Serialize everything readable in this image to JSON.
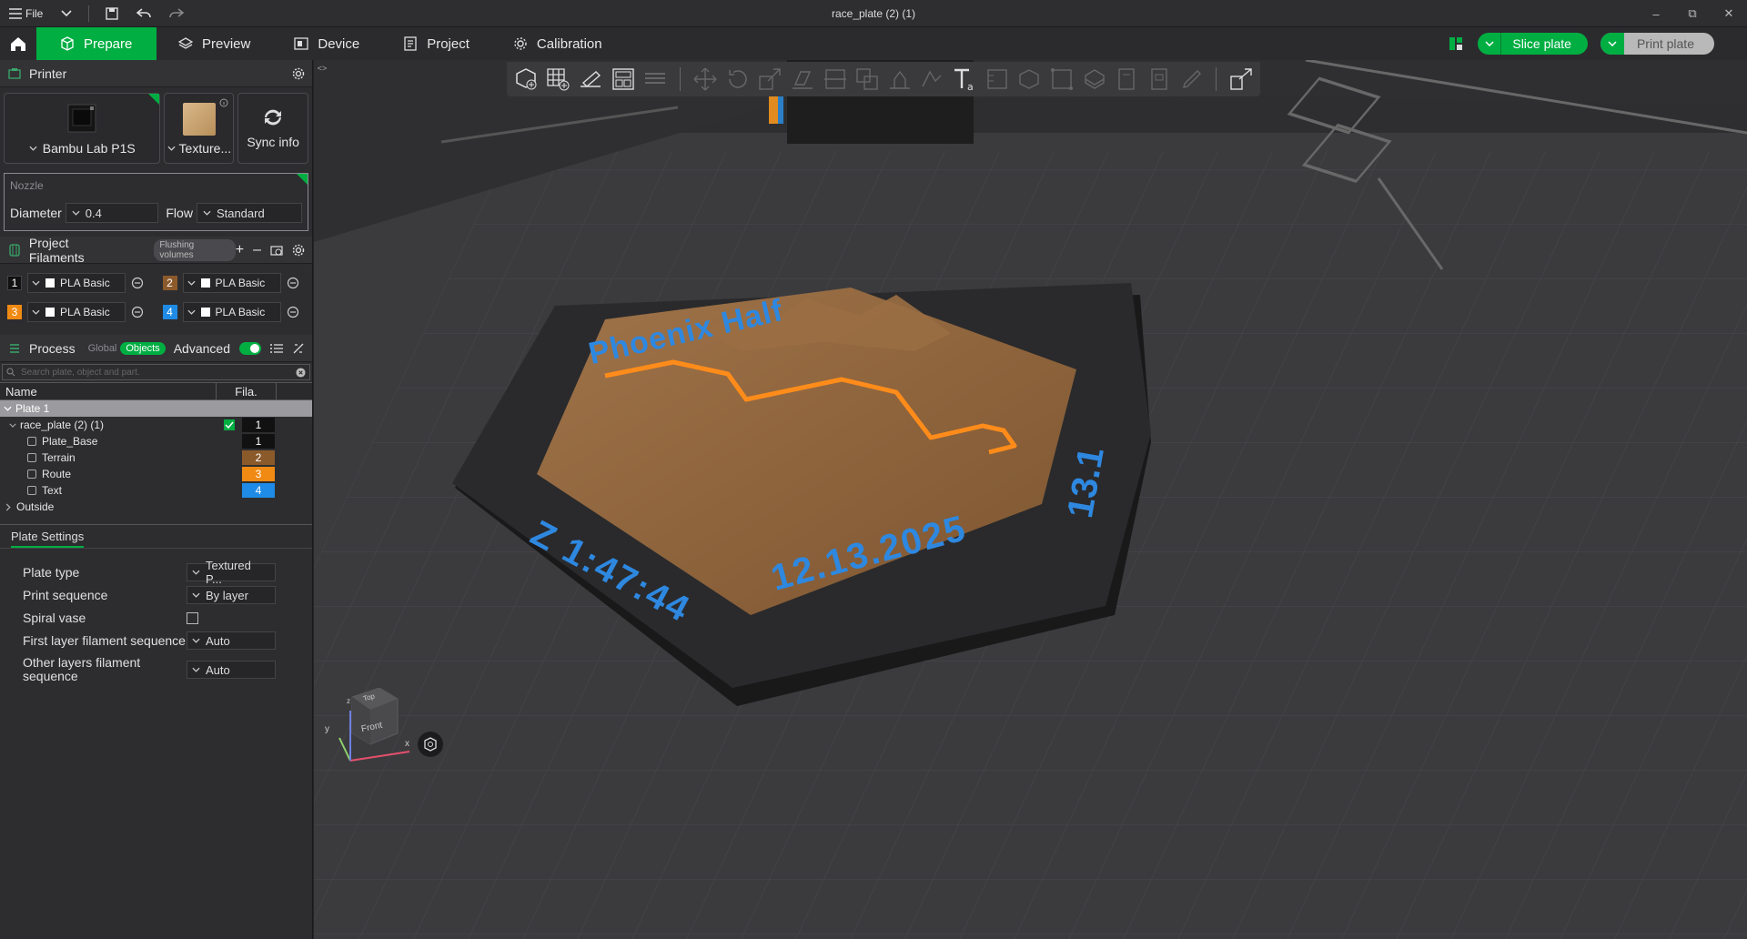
{
  "window": {
    "title": "race_plate (2) (1)",
    "file_label": "File"
  },
  "nav": {
    "tabs": [
      {
        "label": "Prepare"
      },
      {
        "label": "Preview"
      },
      {
        "label": "Device"
      },
      {
        "label": "Project"
      },
      {
        "label": "Calibration"
      }
    ],
    "slice_label": "Slice plate",
    "print_label": "Print plate"
  },
  "printer": {
    "section_title": "Printer",
    "printer_name": "Bambu Lab P1S",
    "plate_label": "Texture...",
    "sync_label": "Sync info",
    "nozzle_title": "Nozzle",
    "diameter_label": "Diameter",
    "diameter_value": "0.4",
    "flow_label": "Flow",
    "flow_value": "Standard"
  },
  "filaments": {
    "section_title": "Project Filaments",
    "flushing_label": "Flushing volumes",
    "items": [
      {
        "num": "1",
        "name": "PLA Basic",
        "color": "#111111"
      },
      {
        "num": "2",
        "name": "PLA Basic",
        "color": "#8b5a2b"
      },
      {
        "num": "3",
        "name": "PLA Basic",
        "color": "#f08a12"
      },
      {
        "num": "4",
        "name": "PLA Basic",
        "color": "#1f8be6"
      }
    ]
  },
  "process": {
    "section_title": "Process",
    "global_label": "Global",
    "objects_label": "Objects",
    "advanced_label": "Advanced",
    "search_placeholder": "Search plate, object and part.",
    "col_name": "Name",
    "col_fila": "Fila.",
    "tree": {
      "plate": "Plate 1",
      "object": "race_plate (2) (1)",
      "object_fila": "1",
      "parts": [
        {
          "name": "Plate_Base",
          "fila": "1",
          "color": "#111111"
        },
        {
          "name": "Terrain",
          "fila": "2",
          "color": "#8b5a2b"
        },
        {
          "name": "Route",
          "fila": "3",
          "color": "#f08a12"
        },
        {
          "name": "Text",
          "fila": "4",
          "color": "#1f8be6"
        }
      ],
      "outside": "Outside"
    }
  },
  "plate_settings": {
    "tab_label": "Plate Settings",
    "rows": [
      {
        "label": "Plate type",
        "value": "Textured P..."
      },
      {
        "label": "Print sequence",
        "value": "By layer"
      },
      {
        "label": "Spiral vase",
        "value": ""
      },
      {
        "label": "First layer filament sequence",
        "value": "Auto"
      },
      {
        "label": "Other layers filament sequence",
        "value": "Auto"
      }
    ]
  },
  "model": {
    "title_text": "Phoenix Half",
    "distance_text": "13.1",
    "time_text": "Z 1:47:44",
    "date_text": "12.13.2025"
  },
  "axes": {
    "top_label": "Top",
    "front_label": "Front",
    "x": "x",
    "y": "y",
    "z": "z"
  }
}
